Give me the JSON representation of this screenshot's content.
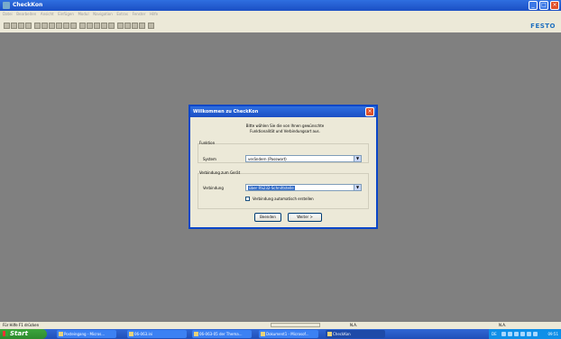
{
  "window": {
    "title": "CheckKon"
  },
  "menu": [
    "Datei",
    "Bearbeiten",
    "Ansicht",
    "Einfügen",
    "Modul",
    "Navigation",
    "Extras",
    "Fenster",
    "Hilfe"
  ],
  "brand": "FESTO",
  "dialog": {
    "title": "Willkommen zu CheckKon",
    "intro_line1": "Bitte wählen Sie die von Ihnen gewünschte",
    "intro_line2": "Funktionalität und Verbindungsart aus.",
    "function_group": "Funktion",
    "system_label": "System",
    "system_value": "verändern (Passwort)",
    "connection_group": "Verbindung zum Gerät",
    "connection_label": "Verbindung",
    "connection_value": "über RS232-Schnittstelle",
    "auto_connect_label": "Verbindung automatisch erstellen",
    "auto_connect_checked": false,
    "exit_button": "Beenden",
    "next_button": "Weiter >"
  },
  "statusbar": {
    "help_text": "Für Hilfe F1 drücken",
    "panel_1": "N.A.",
    "panel_2": "N.A."
  },
  "taskbar": {
    "start": "Start",
    "tasks": [
      {
        "label": "Posteingang - Micros..."
      },
      {
        "label": "06-063.ini"
      },
      {
        "label": "06-063-05 der Thema..."
      },
      {
        "label": "Dokument1 - Microsof..."
      },
      {
        "label": "CheckKon"
      }
    ],
    "lang": "DE",
    "clock": "09:51"
  }
}
